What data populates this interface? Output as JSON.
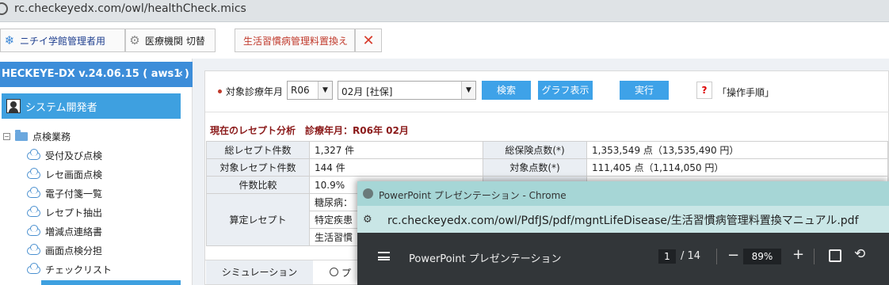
{
  "browser": {
    "url": "rc.checkeyedx.com/owl/healthCheck.mics"
  },
  "toolbar": {
    "admin_label": "ニチイ学館管理者用",
    "switch_label": "医療機関 切替",
    "lifestyle_label": "生活習慣病管理料置換え"
  },
  "sidebar": {
    "header": "HECKEYE-DX v.24.06.15 ( aws1 )",
    "user": "システム開発者",
    "root": "点検業務",
    "items": [
      {
        "label": "受付及び点検"
      },
      {
        "label": "レセ画面点検"
      },
      {
        "label": "電子付箋一覧"
      },
      {
        "label": "レセプト抽出"
      },
      {
        "label": "増減点連絡書"
      },
      {
        "label": "画面点検分担"
      },
      {
        "label": "チェックリスト"
      }
    ]
  },
  "filter": {
    "label": "対象診療年月",
    "year": "R06",
    "month": "02月 [社保]",
    "search": "検索",
    "graph": "グラフ表示",
    "run": "実行",
    "help": "?",
    "manual": "「操作手順」"
  },
  "analysis": {
    "title": "現在のレセプト分析　診療年月：R06年 02月",
    "total_receipts_label": "総レセプト件数",
    "total_receipts": "1,327 件",
    "total_points_label": "総保険点数(*)",
    "total_points": "1,353,549 点（13,535,490 円）",
    "target_receipts_label": "対象レセプト件数",
    "target_receipts": "144 件",
    "target_points_label": "対象点数(*)",
    "target_points": "111,405 点（1,114,050 円）",
    "ratio_label": "件数比較",
    "ratio": "10.9%",
    "calc_label": "算定レセプト",
    "calc_items": [
      "糖尿病：",
      "特定疾患",
      "生活習慣"
    ]
  },
  "simulation": {
    "label": "シミュレーション",
    "option": "プ"
  },
  "popup": {
    "window_title": "PowerPoint プレゼンテーション - Chrome",
    "url": "rc.checkeyedx.com/owl/PdfJS/pdf/mgntLifeDisease/生活習慣病管理料置換マニュアル.pdf",
    "doc_title": "PowerPoint プレゼンテーション",
    "page": "1",
    "page_total": "/ 14",
    "zoom": "89%"
  }
}
